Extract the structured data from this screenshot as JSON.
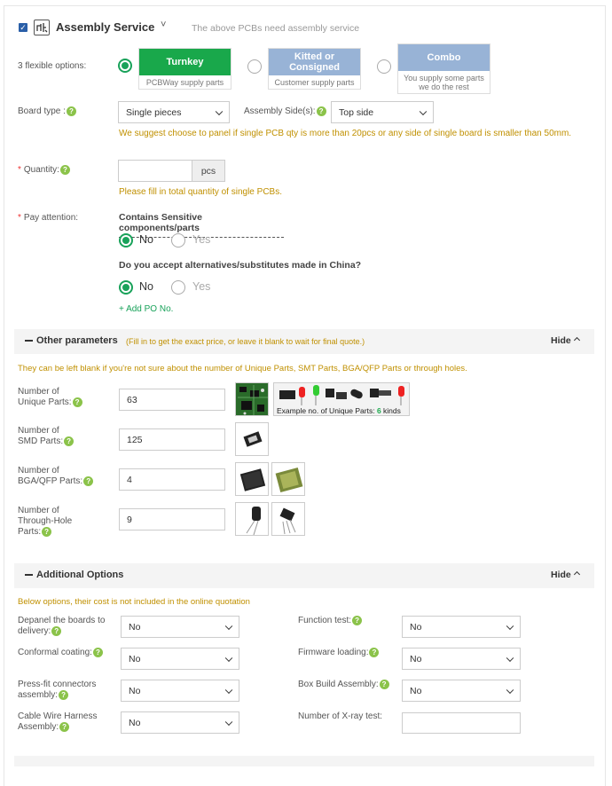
{
  "header": {
    "title": "Assembly Service",
    "subtitle": "The above PCBs need assembly service",
    "title_chevron": "˅"
  },
  "options": {
    "label": "3 flexible options:",
    "turnkey": {
      "title": "Turnkey",
      "desc": "PCBWay supply parts"
    },
    "kitted": {
      "title": "Kitted or Consigned",
      "desc": "Customer supply parts"
    },
    "combo": {
      "title": "Combo",
      "desc": "You supply some parts we do the rest"
    }
  },
  "board_type": {
    "label": "Board type :",
    "value": "Single pieces"
  },
  "assembly_side": {
    "label": "Assembly Side(s):",
    "value": "Top side"
  },
  "panel_suggestion": "We suggest choose to panel if single PCB qty is more than 20pcs or any side of single board is smaller than 50mm.",
  "quantity": {
    "label": "Quantity:",
    "unit": "pcs",
    "value": "",
    "hint": "Please fill in total quantity of single PCBs."
  },
  "attention": {
    "label": "Pay attention:",
    "q1": "Contains Sensitive components/parts",
    "q2": "Do you accept alternatives/substitutes made in China?",
    "no": "No",
    "yes": "Yes",
    "add_po": "+ Add PO No."
  },
  "other": {
    "title": "Other parameters",
    "hint": "(Fill in to get the exact price, or leave it blank to wait for final quote.)",
    "hide": "Hide",
    "note": "They can be left blank if you're not sure about the number of Unique Parts, SMT Parts, BGA/QFP Parts or through holes.",
    "unique": {
      "label_1": "Number of",
      "label_2": "Unique Parts:",
      "value": "63"
    },
    "smd": {
      "label_1": "Number of",
      "label_2": "SMD Parts:",
      "value": "125"
    },
    "bga": {
      "label_1": "Number of",
      "label_2": "BGA/QFP Parts:",
      "value": "4"
    },
    "th": {
      "label_1": "Number of",
      "label_2": "Through-Hole",
      "label_3": "Parts:",
      "value": "9"
    },
    "example_label": "Example no. of Unique Parts:",
    "example_count": "6",
    "example_unit": "kinds"
  },
  "additional": {
    "title": "Additional Options",
    "hide": "Hide",
    "note": "Below options, their cost is not included in the online quotation",
    "depanel": {
      "label_1": "Depanel the boards to",
      "label_2": "delivery:",
      "value": "No"
    },
    "function_test": {
      "label": "Function test:",
      "value": "No"
    },
    "conformal": {
      "label": "Conformal coating:",
      "value": "No"
    },
    "firmware": {
      "label": "Firmware loading:",
      "value": "No"
    },
    "pressfit": {
      "label_1": "Press-fit connectors",
      "label_2": "assembly:",
      "value": "No"
    },
    "boxbuild": {
      "label": "Box Build Assembly:",
      "value": "No"
    },
    "cable": {
      "label_1": "Cable Wire Harness",
      "label_2": "Assembly:",
      "value": "No"
    },
    "xray": {
      "label": "Number of X-ray test:",
      "value": ""
    }
  },
  "help_glyph": "?",
  "colors": {
    "turnkey": "#19a84b",
    "kitted": "#98b3d6",
    "combo": "#98b3d6",
    "accent": "#19a25a",
    "note": "#c09000"
  }
}
